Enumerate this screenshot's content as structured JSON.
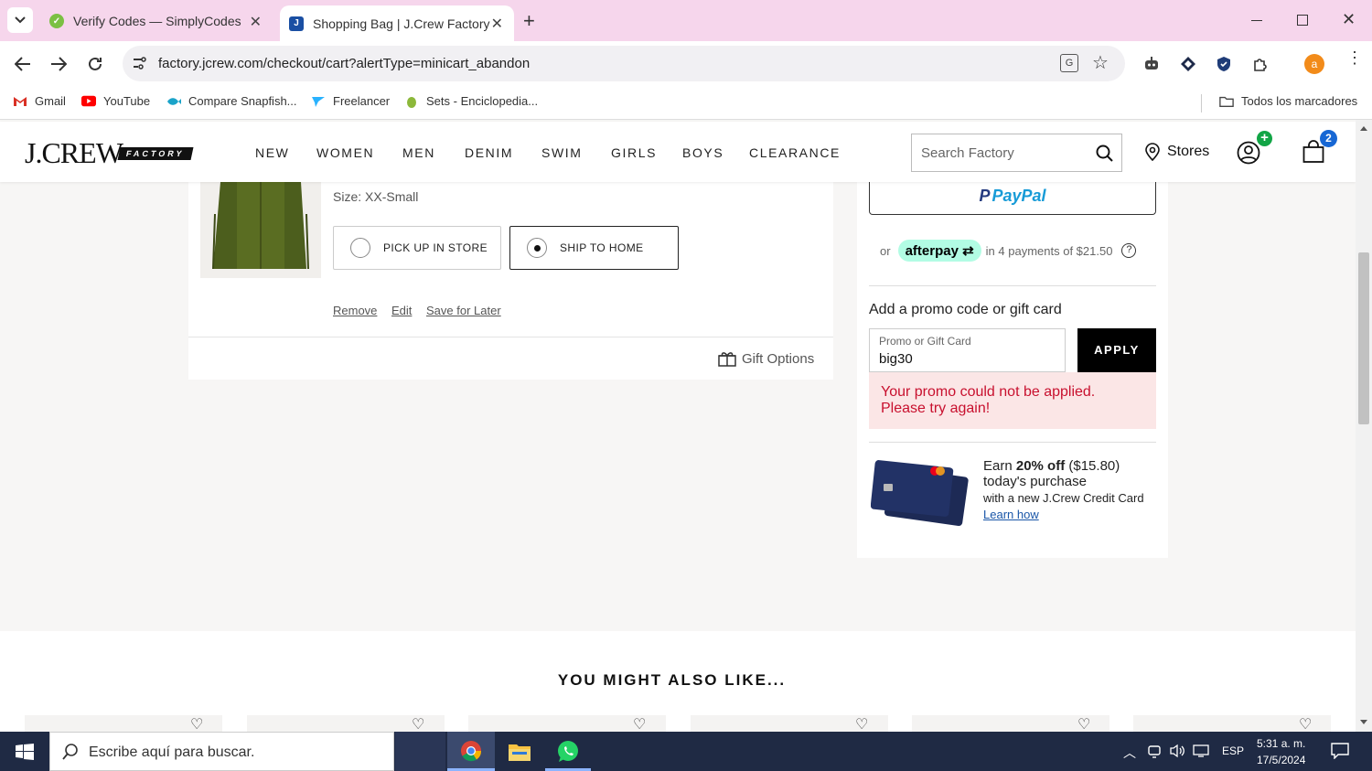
{
  "browser": {
    "tabs": [
      {
        "title": "Verify Codes — SimplyCodes",
        "active": false
      },
      {
        "title": "Shopping Bag | J.Crew Factory",
        "active": true
      }
    ],
    "url": "factory.jcrew.com/checkout/cart?alertType=minicart_abandon",
    "profile_initial": "a",
    "bookmarks": [
      "Gmail",
      "YouTube",
      "Compare Snapfish...",
      "Freelancer",
      "Sets - Enciclopedia..."
    ],
    "all_bookmarks": "Todos los marcadores"
  },
  "site": {
    "logo_main": "J.CREW",
    "logo_sub": "FACTORY",
    "nav": [
      "NEW",
      "WOMEN",
      "MEN",
      "DENIM",
      "SWIM",
      "GIRLS",
      "BOYS",
      "CLEARANCE"
    ],
    "search_placeholder": "Search Factory",
    "stores_label": "Stores",
    "bag_count": "2"
  },
  "cart_item": {
    "size": "Size: XX-Small",
    "pickup_label": "PICK UP IN STORE",
    "ship_label": "SHIP TO HOME",
    "selected": "ship",
    "actions": [
      "Remove",
      "Edit",
      "Save for Later"
    ],
    "gift_options": "Gift Options"
  },
  "summary": {
    "paypal": "PayPal",
    "afterpay_or": "or",
    "afterpay_brand": "afterpay",
    "afterpay_text": "in 4 payments of $21.50",
    "promo_heading": "Add a promo code or gift card",
    "promo_label": "Promo or Gift Card",
    "promo_value": "big30",
    "apply": "APPLY",
    "error_line1": "Your promo could not be applied.",
    "error_line2": "Please try again!",
    "card_earn": "Earn",
    "card_offer": "20% off",
    "card_amount": "($15.80)",
    "card_line2": "today's purchase",
    "card_line3": "with a new J.Crew Credit Card",
    "card_link": "Learn how"
  },
  "recs_title": "YOU MIGHT ALSO LIKE...",
  "taskbar": {
    "search_placeholder": "Escribe aquí para buscar.",
    "lang": "ESP",
    "time": "5:31 a. m.",
    "date": "17/5/2024"
  },
  "colors": {
    "tabstrip": "#f6d6ec",
    "error_bg": "#fbe6e6",
    "error_text": "#c8102e",
    "afterpay": "#b2fce4",
    "taskbar": "#1f2a44"
  }
}
